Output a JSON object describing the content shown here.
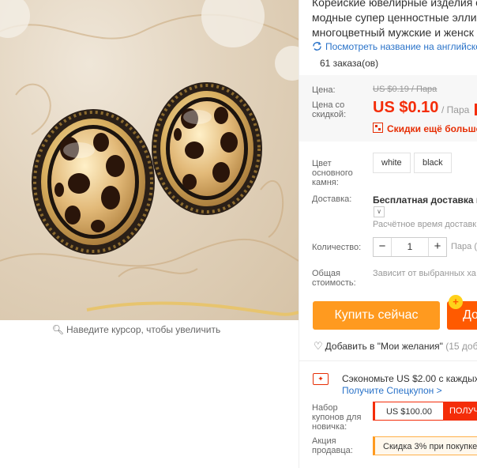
{
  "product": {
    "title_lines": [
      "Корейские ювелирные изделия с",
      "модные супер ценностные эллип",
      "многоцветный мужские и женск"
    ],
    "translate_link": "Посмотреть название на английско",
    "orders": "61 заказа(ов)",
    "zoom_hint": "Наведите курсор, чтобы увеличить"
  },
  "price": {
    "label": "Цена:",
    "old": "US $0.19 / Пара",
    "discount_label": "Цена со скидкой:",
    "new": "US $0.10",
    "unit": "/ Пара",
    "more_discounts": "Скидки ещё больше в"
  },
  "options": {
    "label": "Цвет основного камня:",
    "values": [
      "white",
      "black"
    ]
  },
  "shipping": {
    "label": "Доставка:",
    "title": "Бесплатная доставка в F",
    "time": "Расчётное время доставк"
  },
  "quantity": {
    "label": "Количество:",
    "minus": "−",
    "value": "1",
    "plus": "+",
    "unit": "Пара (3"
  },
  "total": {
    "label": "Общая стоимость:",
    "text": "Зависит от выбранных ха"
  },
  "actions": {
    "buy_now": "Купить сейчас",
    "add_to_cart": "До",
    "cart_badge": "+",
    "wishlist": "Добавить в \"Мои желания\"",
    "wishlist_count": "(15 доба"
  },
  "coupons": {
    "save_text": "Сэкономьте US $2.00 с каждых US",
    "get_link": "Получите Спецкупон >",
    "new_user_label": "Набор купонов для новичка:",
    "new_user_value": "US $100.00",
    "new_user_get": "ПОЛУЧЕ",
    "seller_label": "Акция продавца:",
    "seller_promo": "Скидка 3% при покупке"
  },
  "colors": {
    "accent_red": "#f42d09",
    "buy_orange": "#ff9a1f",
    "cart_orange": "#ff5a00",
    "link_blue": "#2a73c9"
  },
  "icons": [
    "translate-icon",
    "search-icon",
    "qr-icon",
    "heart-icon",
    "coupon-icon",
    "chevron-down-icon"
  ]
}
